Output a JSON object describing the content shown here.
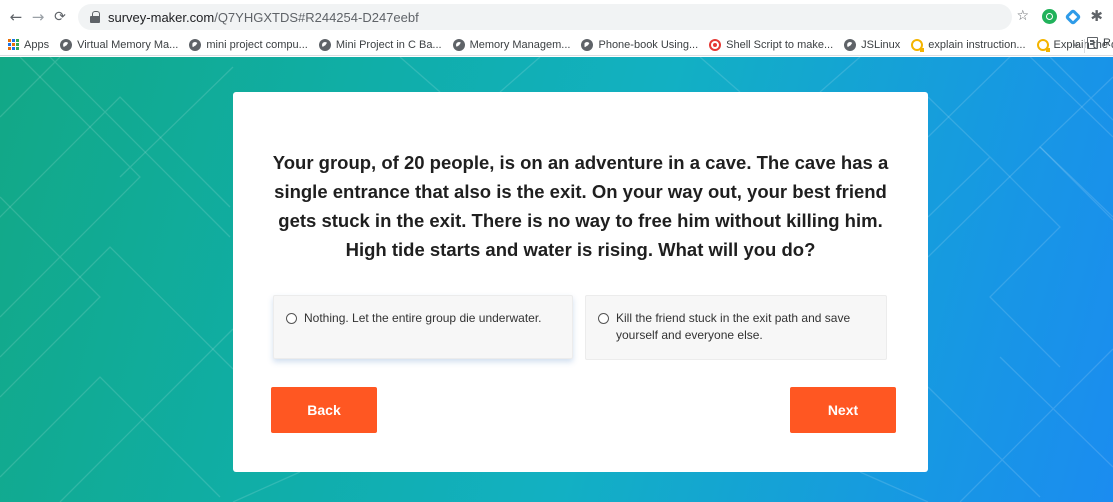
{
  "browser": {
    "url_main": "survey-maker.com",
    "url_path": "/Q7YHGXTDS#R244254-D247eebf"
  },
  "bookmarks": [
    {
      "label": "Apps",
      "icon": "apps-grid-icon"
    },
    {
      "label": "Virtual Memory Ma...",
      "icon": "globe-icon"
    },
    {
      "label": "mini project compu...",
      "icon": "globe-icon"
    },
    {
      "label": "Mini Project in C Ba...",
      "icon": "globe-icon"
    },
    {
      "label": "Memory Managem...",
      "icon": "globe-icon"
    },
    {
      "label": "Phone-book Using...",
      "icon": "globe-icon"
    },
    {
      "label": "Shell Script to make...",
      "icon": "target-icon"
    },
    {
      "label": "JSLinux",
      "icon": "globe-icon"
    },
    {
      "label": "explain instruction...",
      "icon": "ring-icon"
    },
    {
      "label": "Explain the differen...",
      "icon": "ring-icon"
    }
  ],
  "bookmarks_overflow": "»",
  "reading_list_label": "R",
  "survey": {
    "question": "Your group, of 20 people, is on an adventure in a cave. The cave has a single entrance that also is the exit. On your way out, your best friend gets stuck in the exit. There is no way to free him without killing him. High tide starts and water is rising. What will you do?",
    "options": [
      "Nothing. Let the entire group die underwater.",
      "Kill the friend stuck in the exit path and save yourself and everyone else."
    ],
    "back_label": "Back",
    "next_label": "Next"
  },
  "colors": {
    "button": "#ff5722",
    "gradient_start": "#12a886",
    "gradient_end": "#1b8cf0"
  }
}
